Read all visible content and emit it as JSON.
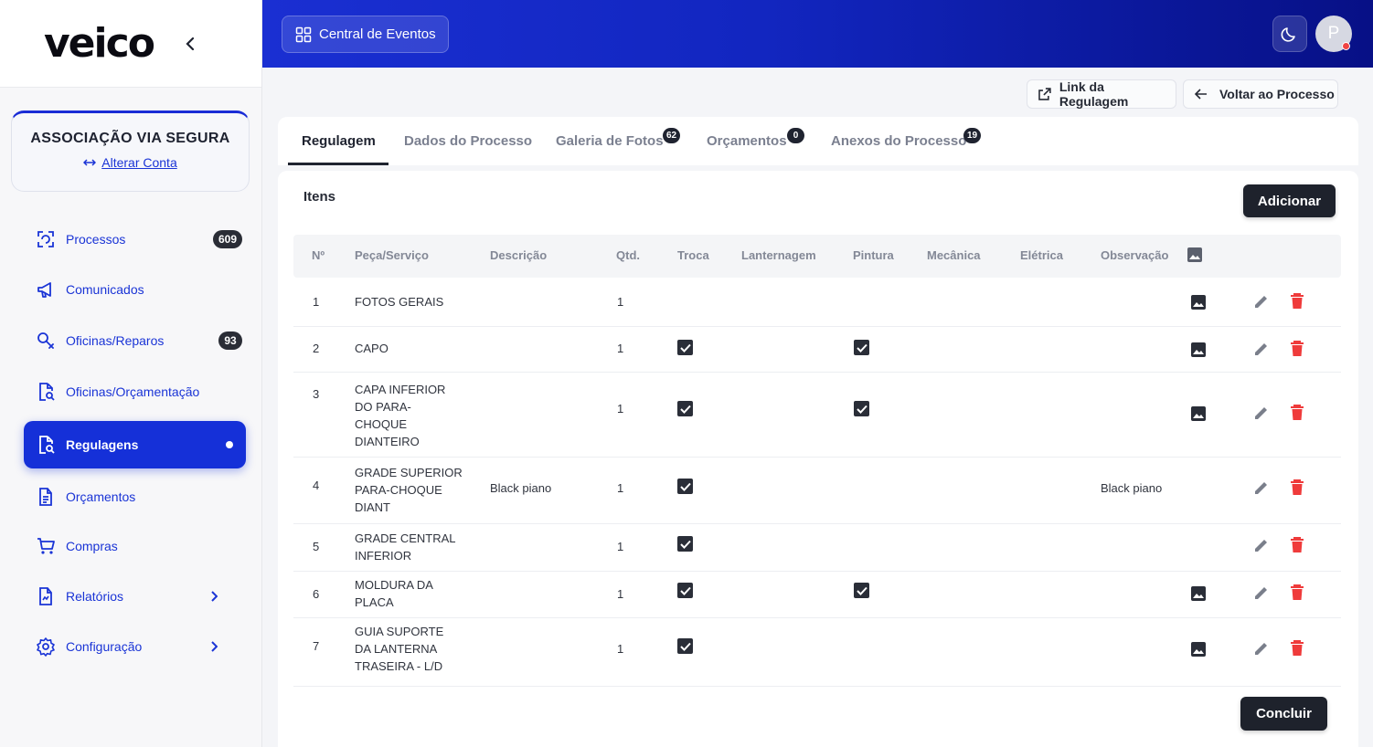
{
  "app": {
    "logo_text": "veico",
    "account_name": "ASSOCIAÇÃO VIA SEGURA",
    "switch_account": "Alterar Conta"
  },
  "sidebar": {
    "items": [
      {
        "label": "Processos",
        "icon": "process-icon",
        "badge": "609"
      },
      {
        "label": "Comunicados",
        "icon": "megaphone-icon"
      },
      {
        "label": "Oficinas/Reparos",
        "icon": "wrench-search-icon",
        "badge": "93"
      },
      {
        "label": "Oficinas/Orçamentação",
        "icon": "document-search-icon"
      },
      {
        "label": "Regulagens",
        "icon": "document-search-icon",
        "active": true
      },
      {
        "label": "Orçamentos",
        "icon": "document-list-icon"
      },
      {
        "label": "Compras",
        "icon": "cart-icon"
      },
      {
        "label": "Relatórios",
        "icon": "report-icon",
        "has_submenu": true
      },
      {
        "label": "Configuração",
        "icon": "gear-icon",
        "has_submenu": true
      }
    ]
  },
  "header": {
    "events_button": "Central de Eventos",
    "avatar_initial": "P"
  },
  "actions": {
    "link_label": "Link da Regulagem",
    "back_label": "Voltar ao Processo"
  },
  "tabs": [
    {
      "label": "Regulagem",
      "active": true
    },
    {
      "label": "Dados do Processo"
    },
    {
      "label": "Galeria de Fotos",
      "badge": "62"
    },
    {
      "label": "Orçamentos",
      "badge": "0"
    },
    {
      "label": "Anexos do Processo",
      "badge": "19"
    }
  ],
  "items_section": {
    "title": "Itens",
    "add_button": "Adicionar",
    "done_button": "Concluir",
    "columns": [
      "Nº",
      "Peça/Serviço",
      "Descrição",
      "Qtd.",
      "Troca",
      "Lanternagem",
      "Pintura",
      "Mecânica",
      "Elétrica",
      "Observação"
    ],
    "rows": [
      {
        "num": "1",
        "piece": "FOTOS GERAIS",
        "description": "",
        "qty": "1",
        "troca": false,
        "pintura": false,
        "observation": "",
        "has_image": true
      },
      {
        "num": "2",
        "piece": "CAPO",
        "description": "",
        "qty": "1",
        "troca": true,
        "pintura": true,
        "observation": "",
        "has_image": true
      },
      {
        "num": "3",
        "piece": "CAPA INFERIOR DO PARA-CHOQUE DIANTEIRO",
        "description": "",
        "qty": "1",
        "troca": true,
        "pintura": true,
        "observation": "",
        "has_image": true
      },
      {
        "num": "4",
        "piece": "GRADE SUPERIOR PARA-CHOQUE DIANT",
        "description": "Black piano",
        "qty": "1",
        "troca": true,
        "pintura": false,
        "observation": "Black piano",
        "has_image": false
      },
      {
        "num": "5",
        "piece": "GRADE CENTRAL INFERIOR",
        "description": "",
        "qty": "1",
        "troca": true,
        "pintura": false,
        "observation": "",
        "has_image": false
      },
      {
        "num": "6",
        "piece": "MOLDURA DA PLACA",
        "description": "",
        "qty": "1",
        "troca": true,
        "pintura": true,
        "observation": "",
        "has_image": true
      },
      {
        "num": "7",
        "piece": "GUIA SUPORTE DA LANTERNA TRASEIRA - L/D",
        "description": "",
        "qty": "1",
        "troca": true,
        "pintura": false,
        "observation": "",
        "has_image": true
      }
    ]
  },
  "colors": {
    "brand_blue": "#1530d8",
    "delete_red": "#ef3b3b",
    "dark_button": "#1e222c"
  }
}
